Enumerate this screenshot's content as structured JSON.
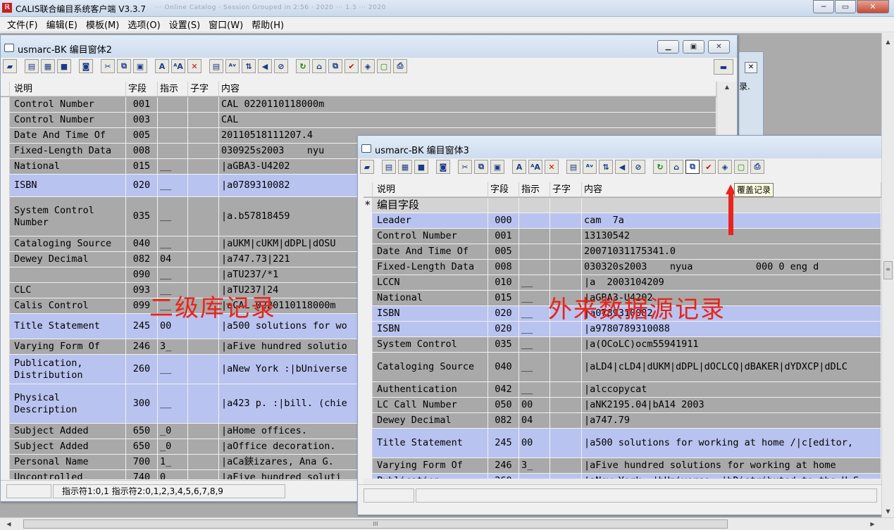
{
  "app": {
    "title": "CALIS联合编目系统客户端 V3.3.7",
    "blurred_caption": "··· Online Catalog · Session Grouped in 2:56 · 2020 ··· 1.3 ··· 2020",
    "min": "─",
    "max": "▭",
    "close": "✕"
  },
  "menu": [
    "文件(F)",
    "编辑(E)",
    "模板(M)",
    "选项(O)",
    "设置(S)",
    "窗口(W)",
    "帮助(H)"
  ],
  "columns": {
    "desc": "说明",
    "field": "字段",
    "ind": "指示",
    "sub": "子字",
    "content": "内容"
  },
  "win2": {
    "title": "usmarc-BK 编目窗体2",
    "rows": [
      {
        "mark": "",
        "desc": "Control Number",
        "field": "001",
        "ind": "",
        "sub": "",
        "content": "CAL 0220110118000m",
        "hl": false
      },
      {
        "mark": "",
        "desc": "Control Number",
        "field": "003",
        "ind": "",
        "sub": "",
        "content": "CAL",
        "hl": false
      },
      {
        "mark": "",
        "desc": "Date And Time Of",
        "field": "005",
        "ind": "",
        "sub": "",
        "content": "20110518111207.4",
        "hl": false
      },
      {
        "mark": "",
        "desc": "Fixed-Length Data",
        "field": "008",
        "ind": "",
        "sub": "",
        "content": "030925s2003    nyu",
        "hl": false
      },
      {
        "mark": "",
        "desc": "National",
        "field": "015",
        "ind": "__",
        "sub": "",
        "content": "|aGBA3-U4202",
        "hl": false
      },
      {
        "mark": "",
        "desc": "ISBN",
        "field": "020",
        "ind": "__",
        "sub": "",
        "content": "|a0789310082",
        "hl": true
      },
      {
        "mark": "",
        "desc": "System Control\nNumber",
        "field": "035",
        "ind": "__",
        "sub": "",
        "content": "|a.b57818459",
        "hl": false
      },
      {
        "mark": "",
        "desc": "Cataloging Source",
        "field": "040",
        "ind": "__",
        "sub": "",
        "content": "|aUKM|cUKM|dDPL|dOSU",
        "hl": false
      },
      {
        "mark": "",
        "desc": "Dewey Decimal",
        "field": "082",
        "ind": "04",
        "sub": "",
        "content": "|a747.73|221",
        "hl": false
      },
      {
        "mark": "",
        "desc": "",
        "field": "090",
        "ind": "__",
        "sub": "",
        "content": "|aTU237/*1",
        "hl": false
      },
      {
        "mark": "",
        "desc": "CLC",
        "field": "093",
        "ind": "__",
        "sub": "",
        "content": "|aTU237|24",
        "hl": false
      },
      {
        "mark": "",
        "desc": "Calis Control",
        "field": "099",
        "ind": "__",
        "sub": "",
        "content": "|aCAL 0220110118000m",
        "hl": false
      },
      {
        "mark": "",
        "desc": "Title Statement",
        "field": "245",
        "ind": "00",
        "sub": "",
        "content": "|a500 solutions for wo",
        "hl": true
      },
      {
        "mark": "",
        "desc": "Varying Form Of",
        "field": "246",
        "ind": "3_",
        "sub": "",
        "content": "|aFive hundred solutio",
        "hl": false
      },
      {
        "mark": "",
        "desc": "Publication,\nDistribution",
        "field": "260",
        "ind": "__",
        "sub": "",
        "content": "|aNew York :|bUniverse",
        "hl": true
      },
      {
        "mark": "",
        "desc": "Physical\nDescription",
        "field": "300",
        "ind": "__",
        "sub": "",
        "content": "|a423 p. :|bill. (chie",
        "hl": true
      },
      {
        "mark": "",
        "desc": "Subject Added",
        "field": "650",
        "ind": "_0",
        "sub": "",
        "content": "|aHome offices.",
        "hl": false
      },
      {
        "mark": "",
        "desc": "Subject Added",
        "field": "650",
        "ind": "_0",
        "sub": "",
        "content": "|aOffice decoration.",
        "hl": false
      },
      {
        "mark": "",
        "desc": "Personal Name",
        "field": "700",
        "ind": "1_",
        "sub": "",
        "content": "|aCa鋏izares, Ana G.",
        "hl": false
      },
      {
        "mark": "",
        "desc": "Uncontrolled",
        "field": "740",
        "ind": "0_",
        "sub": "",
        "content": "|aFive hundred soluti",
        "hl": false
      }
    ],
    "status": "指示符1:0,1 指示符2:0,1,2,3,4,5,6,7,8,9"
  },
  "win3": {
    "title": "usmarc-BK 编目窗体3",
    "rows": [
      {
        "mark": "*",
        "desc": "编目字段",
        "field": "",
        "ind": "",
        "sub": "",
        "content": "",
        "hl": false
      },
      {
        "mark": "",
        "desc": "Leader",
        "field": "000",
        "ind": "",
        "sub": "",
        "content": "cam  7a",
        "hl": true
      },
      {
        "mark": "",
        "desc": "Control Number",
        "field": "001",
        "ind": "",
        "sub": "",
        "content": "13130542",
        "hl": false
      },
      {
        "mark": "",
        "desc": "Date And Time Of",
        "field": "005",
        "ind": "",
        "sub": "",
        "content": "20071031175341.0",
        "hl": false
      },
      {
        "mark": "",
        "desc": "Fixed-Length Data",
        "field": "008",
        "ind": "",
        "sub": "",
        "content": "030320s2003    nyua           000 0 eng d",
        "hl": false
      },
      {
        "mark": "",
        "desc": "LCCN",
        "field": "010",
        "ind": "__",
        "sub": "",
        "content": "|a  2003104209",
        "hl": false
      },
      {
        "mark": "",
        "desc": "National",
        "field": "015",
        "ind": "__",
        "sub": "",
        "content": "|aGBA3-U4202",
        "hl": false
      },
      {
        "mark": "",
        "desc": "ISBN",
        "field": "020",
        "ind": "__",
        "sub": "",
        "content": "|a0789310082",
        "hl": true
      },
      {
        "mark": "",
        "desc": "ISBN",
        "field": "020",
        "ind": "__",
        "sub": "",
        "content": "|a9780789310088",
        "hl": true
      },
      {
        "mark": "",
        "desc": "System Control",
        "field": "035",
        "ind": "__",
        "sub": "",
        "content": "|a(OCoLC)ocm55941911",
        "hl": false
      },
      {
        "mark": "",
        "desc": "Cataloging Source",
        "field": "040",
        "ind": "__",
        "sub": "",
        "content": "|aLD4|cLD4|dUKM|dDPL|dOCLCQ|dBAKER|dYDXCP|dDLC",
        "hl": false
      },
      {
        "mark": "",
        "desc": "Authentication",
        "field": "042",
        "ind": "__",
        "sub": "",
        "content": "|alccopycat",
        "hl": false
      },
      {
        "mark": "",
        "desc": "LC Call Number",
        "field": "050",
        "ind": "00",
        "sub": "",
        "content": "|aNK2195.04|bA14 2003",
        "hl": false
      },
      {
        "mark": "",
        "desc": "Dewey Decimal",
        "field": "082",
        "ind": "04",
        "sub": "",
        "content": "|a747.79",
        "hl": false
      },
      {
        "mark": "",
        "desc": "Title Statement",
        "field": "245",
        "ind": "00",
        "sub": "",
        "content": "|a500 solutions for working at home /|c[editor,",
        "hl": true
      },
      {
        "mark": "",
        "desc": "Varying Form Of",
        "field": "246",
        "ind": "3_",
        "sub": "",
        "content": "|aFive hundred solutions for working at home",
        "hl": false
      },
      {
        "mark": "",
        "desc": "Publication,",
        "field": "260",
        "ind": "__",
        "sub": "",
        "content": "|aNew York :|bUniverse :|bDistributed to the U.S",
        "hl": true
      }
    ]
  },
  "annotations": {
    "left": "二级库记录",
    "right": "外来数据源记录"
  },
  "tooltip": "覆盖记录",
  "win_partial_text": "录."
}
